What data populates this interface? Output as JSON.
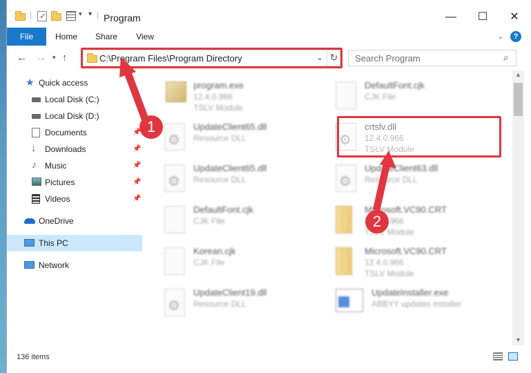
{
  "window": {
    "title": "Program"
  },
  "window_controls": {
    "minimize": "—",
    "maximize": "☐",
    "close": "✕"
  },
  "ribbon": {
    "tabs": [
      {
        "label": "File"
      },
      {
        "label": "Home"
      },
      {
        "label": "Share"
      },
      {
        "label": "View"
      }
    ],
    "help": "?"
  },
  "navigation": {
    "back": "←",
    "forward": "→",
    "up": "↑"
  },
  "address": {
    "path": "C:\\Program Files\\Program Directory"
  },
  "search": {
    "placeholder": "Search Program"
  },
  "sidebar": {
    "items": [
      {
        "label": "Quick access",
        "icon": "star-icon"
      },
      {
        "label": "Local Disk (C:)",
        "icon": "drive-icon"
      },
      {
        "label": "Local Disk (D:)",
        "icon": "drive-icon"
      },
      {
        "label": "Documents",
        "icon": "documents-icon",
        "pinned": true
      },
      {
        "label": "Downloads",
        "icon": "download-icon",
        "pinned": true
      },
      {
        "label": "Music",
        "icon": "music-icon",
        "pinned": true
      },
      {
        "label": "Pictures",
        "icon": "pictures-icon",
        "pinned": true
      },
      {
        "label": "Videos",
        "icon": "videos-icon",
        "pinned": true
      },
      {
        "label": "OneDrive",
        "icon": "cloud-icon"
      },
      {
        "label": "This PC",
        "icon": "pc-icon",
        "selected": true
      },
      {
        "label": "Network",
        "icon": "network-icon"
      }
    ]
  },
  "files": [
    {
      "name": "program.exe",
      "line1": "12.4.0.966",
      "line2": "TSLV Module",
      "icon": "exe-icon"
    },
    {
      "name": "DefaultFont.cjk",
      "line1": "CJK File",
      "line2": "",
      "icon": "file-icon"
    },
    {
      "name": "UpdateClient65.dll",
      "line1": "Resource DLL",
      "line2": "",
      "icon": "dll-icon"
    },
    {
      "name": "crtslv.dll",
      "line1": "12.4.0.966",
      "line2": "TSLV Module",
      "icon": "dll-icon"
    },
    {
      "name": "UpdateClient65.dll",
      "line1": "Resource DLL",
      "line2": "",
      "icon": "dll-icon"
    },
    {
      "name": "UpdateClient63.dll",
      "line1": "Resource DLL",
      "line2": "",
      "icon": "dll-icon"
    },
    {
      "name": "DefaultFont.cjk",
      "line1": "CJK File",
      "line2": "",
      "icon": "file-icon"
    },
    {
      "name": "Microsoft.VC90.CRT",
      "line1": "12.4.0.966",
      "line2": "TSLV Module",
      "icon": "crt-icon"
    },
    {
      "name": "Korean.cjk",
      "line1": "CJK File",
      "line2": "",
      "icon": "file-icon"
    },
    {
      "name": "Microsoft.VC90.CRT",
      "line1": "12.4.0.966",
      "line2": "TSLV Module",
      "icon": "crt-icon"
    },
    {
      "name": "UpdateClient19.dll",
      "line1": "Resource DLL",
      "line2": "",
      "icon": "dll-icon"
    },
    {
      "name": "UpdateInstaller.exe",
      "line1": "ABBYY updates installer",
      "line2": "",
      "icon": "installer-icon"
    }
  ],
  "annotations": {
    "step1": "1",
    "step2": "2"
  },
  "status": {
    "count": "136 items"
  },
  "colors": {
    "accent": "#1979ca",
    "highlight": "#e0363f",
    "selected": "#cce8ff"
  }
}
